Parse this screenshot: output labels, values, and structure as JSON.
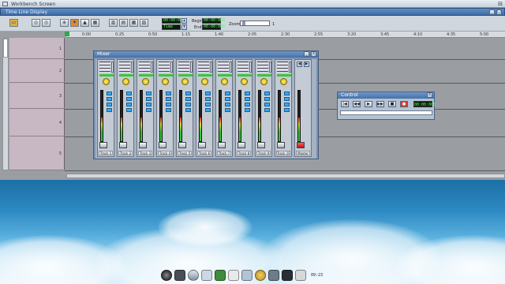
{
  "workbench": {
    "title": "Workbench Screen"
  },
  "timeline_window": {
    "title": "Time Line Display"
  },
  "toolbar": {
    "clock_1": "00:00:000",
    "clock_2_value": "Time",
    "begin_label": "Begin",
    "begin_value": "00:00:000",
    "end_label": "End",
    "end_value": "00:00:000",
    "zoom_label": "Zoom",
    "zoom_value": "1"
  },
  "ruler": {
    "ticks": [
      "0:00",
      "0:25",
      "0:50",
      "1:15",
      "1:40",
      "2:05",
      "2:30",
      "2:55",
      "3:20",
      "3:45",
      "4:10",
      "4:35",
      "5:00"
    ]
  },
  "tracks": [
    "1",
    "2",
    "3",
    "4",
    "5"
  ],
  "mixer": {
    "title": "Mixer",
    "strips": [
      "Track 1",
      "Track 2",
      "Track 3",
      "Track 4",
      "Track 5",
      "Track 6",
      "Track 7",
      "Track 8",
      "Track 9",
      "Track 10"
    ],
    "master_label": "Master"
  },
  "control": {
    "title": "Control",
    "buttons": [
      "|◀",
      "◀◀",
      "▶",
      "▶▶",
      "■",
      "●"
    ],
    "time": "00:00:000"
  },
  "dock": {
    "clock": "09:23"
  },
  "colors": {
    "title_blue": "#4572a8",
    "lcd_green": "#5cff5c",
    "led_green": "#39c739",
    "button_blue": "#38a8f0",
    "record_red": "#d93b2b"
  }
}
